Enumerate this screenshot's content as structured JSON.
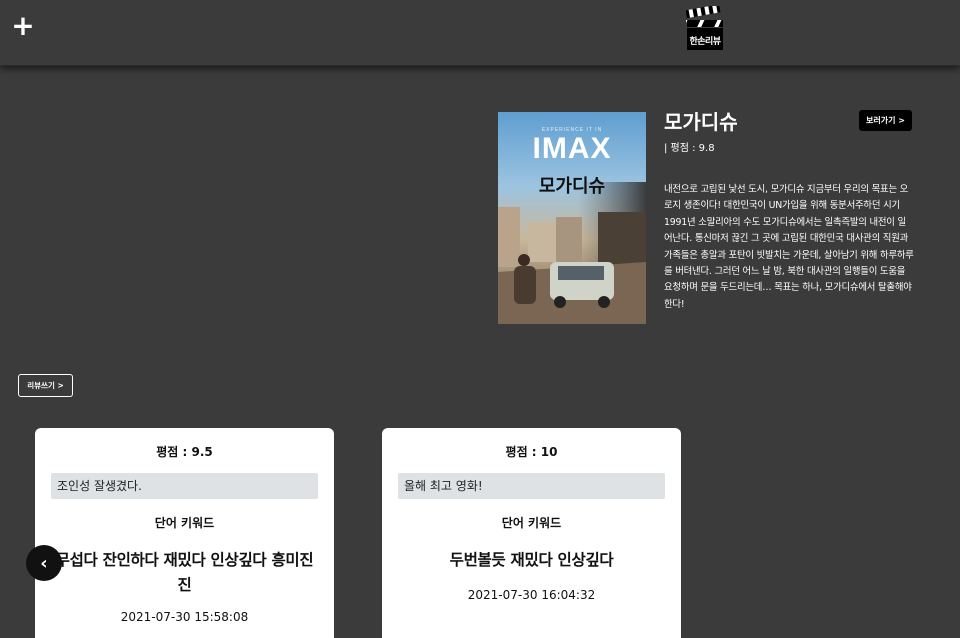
{
  "header": {
    "plus_icon": "plus-icon",
    "logo_text": "한손리뷰"
  },
  "movie": {
    "poster": {
      "tagline": "EXPERIENCE IT IN",
      "imax": "IMAX",
      "title": "모가디슈"
    },
    "title": "모가디슈",
    "rating": "| 평점 : 9.8",
    "watch_label": "보러가기 >",
    "synopsis": "내전으로 고립된 낯선 도시, 모가디슈 지금부터 우리의 목표는 오로지 생존이다! 대한민국이 UN가입을 위해 동분서주하던 시기 1991년 소말리아의 수도 모가디슈에서는 일촉즉발의 내전이 일어난다. 통신마저 끊긴 그 곳에 고립된 대한민국 대사관의 직원과 가족들은 총알과 포탄이 빗발치는 가운데, 살아남기 위해 하루하루를 버텨낸다. 그러던 어느 날 밤, 북한 대사관의 일행들이 도움을 요청하며 문을 두드리는데… 목표는 하나, 모가디슈에서 탈출해야 한다!"
  },
  "write_review_label": "리뷰쓰기 >",
  "reviews": [
    {
      "rating": "평점 : 9.5",
      "comment": "조인성 잘생겼다.",
      "keyword_label": "단어 키워드",
      "keywords": "무섭다 잔인하다 재밌다 인상깊다 흥미진진",
      "date": "2021-07-30 15:58:08"
    },
    {
      "rating": "평점 : 10",
      "comment": "올해 최고 영화!",
      "keyword_label": "단어 키워드",
      "keywords": "두번볼듯 재밌다 인상깊다",
      "date": "2021-07-30 16:04:32"
    }
  ],
  "prev_arrow": "‹",
  "colors": {
    "background": "#3b3b3b",
    "card": "#ffffff",
    "comment_box": "#dfe2e5",
    "button_dark": "#000000"
  }
}
